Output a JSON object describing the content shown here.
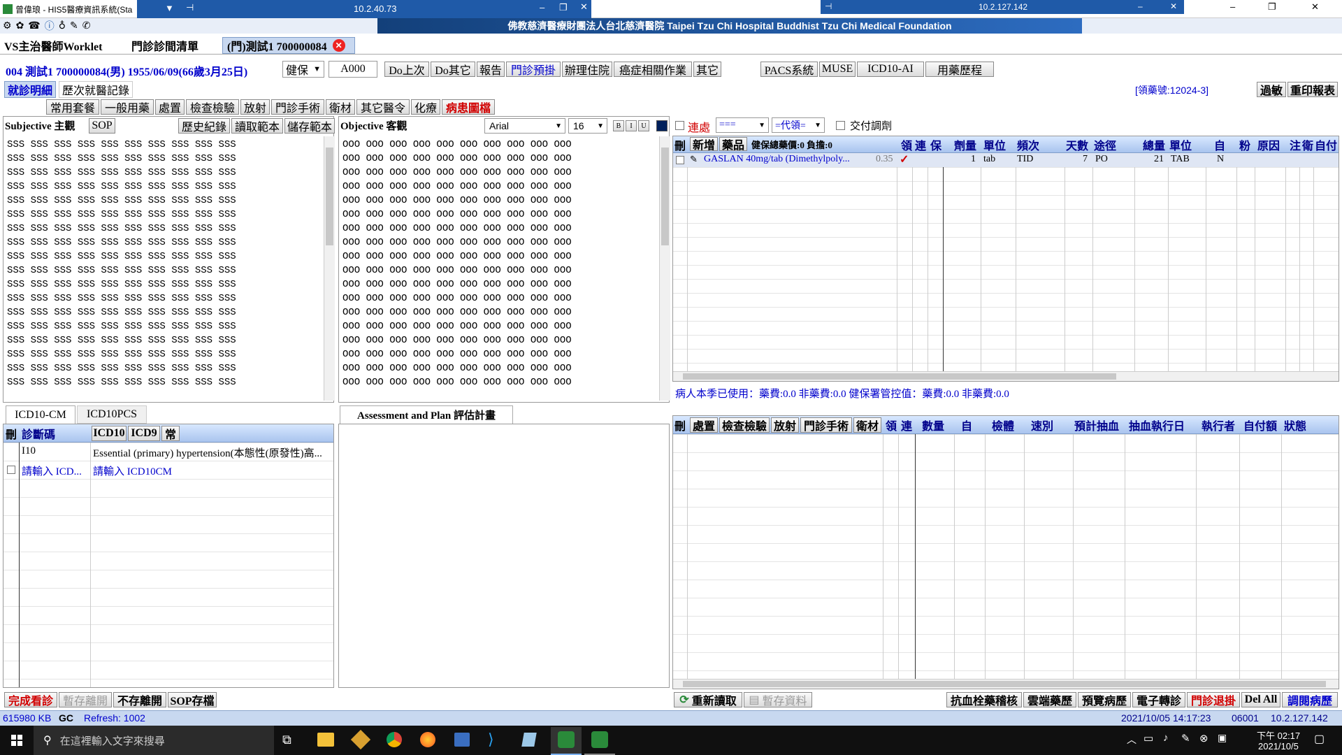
{
  "titlebar": {
    "app_title": "曾偉琅 - HIS5醫療資訊系統(Sta",
    "remote_ip1": "10.2.40.73",
    "remote_ip2": "10.2.127.142",
    "hospital_banner": "佛教慈濟醫療財團法人台北慈濟醫院 Taipei Tzu Chi Hospital Buddhist Tzu Chi Medical Foundation"
  },
  "doc_tabs": [
    "VS主治醫師Worklet",
    "門診診間清單",
    "(門)測試1 700000084"
  ],
  "patient_bar": {
    "info": "004  測試1 700000084(男) 1955/06/09(66歲3月25日)",
    "insurance": "健保",
    "code": "A000",
    "buttons": [
      "Do上次",
      "Do其它",
      "報告",
      "門診預掛",
      "辦理住院",
      "癌症相關作業",
      "其它",
      "PACS系統",
      "MUSE",
      "ICD10-AI",
      "用藥歷程"
    ]
  },
  "sub_tabs": [
    "就診明細",
    "歷次就醫記錄"
  ],
  "allergy_label": "[領藥號:12024-3]",
  "right_buttons": [
    "過敏",
    "重印報表"
  ],
  "order_buttons": [
    "常用套餐",
    "一般用藥",
    "處置",
    "檢查檢驗",
    "放射",
    "門診手術",
    "衛材",
    "其它醫令",
    "化療",
    "病患圖檔"
  ],
  "subjective": {
    "title": "Subjective 主觀",
    "sop": "SOP",
    "buttons": [
      "歷史紀錄",
      "讀取範本",
      "儲存範本"
    ],
    "line": "SSS SSS SSS SSS SSS SSS SSS SSS SSS SSS",
    "line_count": 18
  },
  "objective": {
    "title": "Objective 客觀",
    "font": "Arial",
    "size": "16",
    "format": [
      "B",
      "I",
      "U"
    ],
    "line": "OOO OOO OOO OOO OOO OOO OOO OOO OOO OOO",
    "line_count": 18
  },
  "med_toolbar": {
    "link_label": "連處",
    "select1": "===",
    "select2": "=代領=",
    "transfer_label": "交付調劑"
  },
  "med_table": {
    "add_label": "新增",
    "drug_label": "藥品",
    "summary": "健保總藥價:0 負擔:0",
    "columns": [
      "領",
      "連",
      "保",
      "劑量",
      "單位",
      "頻次",
      "天數",
      "途徑",
      "總量",
      "單位",
      "自",
      "粉",
      "原因",
      "注",
      "衛",
      "自付"
    ],
    "rows": [
      {
        "name": "GASLAN 40mg/tab (Dimethylpoly...",
        "price": "0.35",
        "check": "✓",
        "dose": "1",
        "unit": "tab",
        "freq": "TID",
        "days": "7",
        "route": "PO",
        "total": "21",
        "tunit": "TAB",
        "self": "N"
      }
    ]
  },
  "quota_text": "病人本季已使用：藥費:0.0 非藥費:0.0 健保署管控值：藥費:0.0 非藥費:0.0",
  "icd": {
    "tabs": [
      "ICD10-CM",
      "ICD10PCS"
    ],
    "header": "診斷碼",
    "btns": [
      "ICD10",
      "ICD9",
      "常"
    ],
    "rows": [
      {
        "code": "I10",
        "desc": "Essential (primary) hypertension(本態性(原發性)高..."
      },
      {
        "code": "請輸入 ICD...",
        "desc": "請輸入 ICD10CM"
      }
    ]
  },
  "assessment": {
    "title": "Assessment and Plan 評估計畫"
  },
  "proc_table": {
    "columns": [
      "處置",
      "檢查檢驗",
      "放射",
      "門診手術",
      "衛材",
      "領",
      "連",
      "數量",
      "自",
      "檢體",
      "速別",
      "預計抽血",
      "抽血執行日",
      "執行者",
      "自付額",
      "狀態"
    ]
  },
  "bottom_left_buttons": [
    "完成看診",
    "暫存離開",
    "不存離開",
    "SOP存檔"
  ],
  "bottom_mid_buttons": [
    "重新讀取",
    "暫存資料"
  ],
  "bottom_right_buttons": [
    "抗血栓藥稽核",
    "雲端藥歷",
    "預覽病歷",
    "電子轉診",
    "門診退掛",
    "Del All",
    "調閱病歷"
  ],
  "statusbar": {
    "memory": "615980 KB",
    "gc": "GC",
    "refresh": "Refresh: 1002",
    "datetime": "2021/10/05 14:17:23",
    "code": "06001",
    "ip": "10.2.127.142"
  },
  "taskbar": {
    "search_placeholder": "在這裡輸入文字來搜尋",
    "time": "下午 02:17",
    "date": "2021/10/5"
  },
  "colors": {
    "titlebar": "#1f5aa8",
    "header_blue": "#a9c4ee",
    "status_bar": "#c8d8f0",
    "taskbar": "#101010",
    "accent_red": "#d10000"
  }
}
